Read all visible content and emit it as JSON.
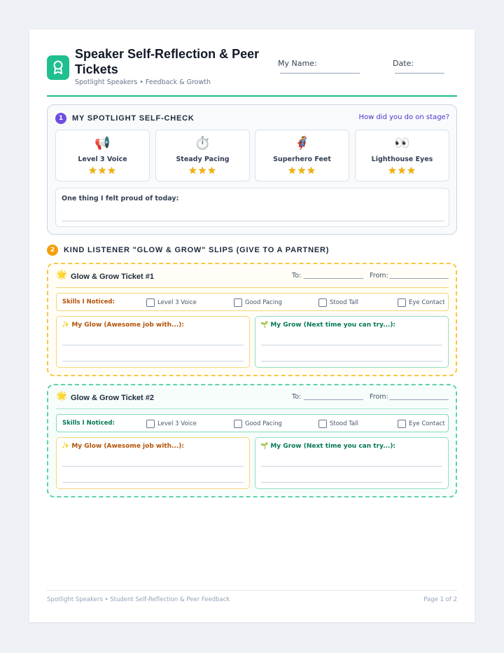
{
  "header": {
    "title": "Speaker Self-Reflection & Peer Tickets",
    "subtitle": "Spotlight Speakers • Feedback & Growth",
    "name_label": "My Name:",
    "date_label": "Date:",
    "logo_icon": "award-ribbon-icon",
    "accent": "#1fbf8f"
  },
  "self_check": {
    "number": "1",
    "title": "MY SPOTLIGHT SELF-CHECK",
    "prompt": "How did you do on stage?",
    "skills": [
      {
        "icon": "📢",
        "icon_name": "megaphone-icon",
        "label": "Level 3 Voice",
        "stars": "★★★"
      },
      {
        "icon": "⏱️",
        "icon_name": "stopwatch-icon",
        "label": "Steady Pacing",
        "stars": "★★★"
      },
      {
        "icon": "🦸",
        "icon_name": "superhero-icon",
        "label": "Superhero Feet",
        "stars": "★★★"
      },
      {
        "icon": "👀",
        "icon_name": "eyes-icon",
        "label": "Lighthouse Eyes",
        "stars": "★★★"
      }
    ],
    "proud_label": "One thing I felt proud of today:"
  },
  "peer": {
    "number": "2",
    "title": "KIND LISTENER \"GLOW & GROW\" SLIPS (GIVE TO A PARTNER)",
    "tickets": [
      {
        "icon": "🌟",
        "title": "Glow & Grow Ticket #1",
        "to_label": "To:",
        "from_label": "From:",
        "skills_label": "Skills I Noticed:",
        "checkboxes": [
          "Level 3 Voice",
          "Good Pacing",
          "Stood Tall",
          "Eye Contact"
        ],
        "glow_label": "✨ My Glow (Awesome job with...):",
        "grow_label": "🌱 My Grow (Next time you can try...):",
        "border_color": "#f6c744"
      },
      {
        "icon": "🌟",
        "title": "Glow & Grow Ticket #2",
        "to_label": "To:",
        "from_label": "From:",
        "skills_label": "Skills I Noticed:",
        "checkboxes": [
          "Level 3 Voice",
          "Good Pacing",
          "Stood Tall",
          "Eye Contact"
        ],
        "glow_label": "✨ My Glow (Awesome job with...):",
        "grow_label": "🌱 My Grow (Next time you can try...):",
        "border_color": "#5fd3a8"
      }
    ]
  },
  "footer": {
    "left": "Spotlight Speakers • Student Self-Reflection & Peer Feedback",
    "right": "Page 1 of 2"
  }
}
